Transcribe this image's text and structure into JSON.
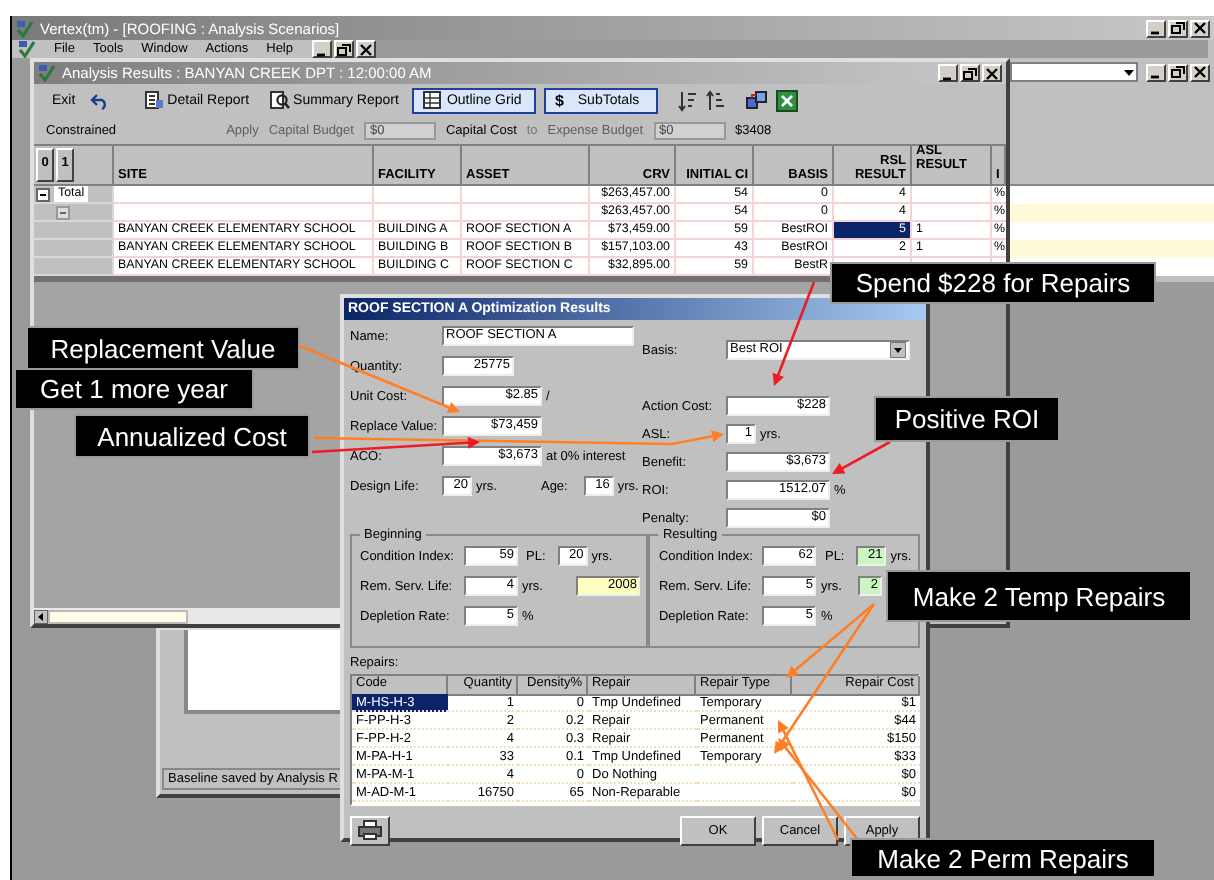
{
  "app_window": {
    "title": "Vertex(tm) - [ROOFING : Analysis Scenarios]",
    "menu": [
      "File",
      "Tools",
      "Window",
      "Actions",
      "Help"
    ]
  },
  "results_window": {
    "title": "Analysis Results : BANYAN CREEK DPT : 12:00:00 AM",
    "toolbar": {
      "exit": "Exit",
      "detail_report": "Detail Report",
      "summary_report": "Summary Report",
      "outline_grid": {
        "label": "Outline Grid",
        "on": true
      },
      "subtotals": {
        "symbol": "$",
        "label": "SubTotals",
        "on": true
      }
    },
    "budget": {
      "mode": "Constrained",
      "apply": {
        "label": "Apply",
        "disabled": true
      },
      "capital_budget": {
        "label": "Capital Budget",
        "value": "$0",
        "disabled": true
      },
      "capital_cost": "Capital Cost",
      "to": "to",
      "expense_budget": {
        "label": "Expense Budget",
        "value": "$0",
        "disabled": true
      },
      "total": "$3408"
    },
    "grid": {
      "levels": [
        "0",
        "1"
      ],
      "columns": [
        "SITE",
        "FACILITY",
        "ASSET",
        "CRV",
        "INITIAL CI",
        "BASIS",
        "RSL RESULT",
        "ASL RESULT",
        "I"
      ],
      "rows": [
        {
          "kind": "total",
          "label": "Total",
          "expanded": true,
          "selected": false,
          "cells": [
            "",
            "",
            "",
            "$263,457.00",
            "54",
            "0",
            "4",
            "",
            "%"
          ]
        },
        {
          "kind": "group",
          "expanded": true,
          "selected": false,
          "cells": [
            "",
            "",
            "",
            "$263,457.00",
            "54",
            "0",
            "4",
            "",
            "%"
          ]
        },
        {
          "kind": "asset",
          "selected": true,
          "cells": [
            "BANYAN CREEK ELEMENTARY SCHOOL",
            "BUILDING A",
            "ROOF SECTION A",
            "$73,459.00",
            "59",
            "BestROI",
            "5",
            "1",
            "%"
          ]
        },
        {
          "kind": "asset",
          "selected": false,
          "cells": [
            "BANYAN CREEK ELEMENTARY SCHOOL",
            "BUILDING B",
            "ROOF SECTION B",
            "$157,103.00",
            "43",
            "BestROI",
            "2",
            "1",
            "%"
          ]
        },
        {
          "kind": "asset",
          "selected": false,
          "cells": [
            "BANYAN CREEK ELEMENTARY SCHOOL",
            "BUILDING C",
            "ROOF SECTION C",
            "$32,895.00",
            "59",
            "BestR",
            "",
            "",
            ""
          ]
        }
      ]
    }
  },
  "baseline_window": {
    "status": "Baseline saved by Analysis R"
  },
  "dialog": {
    "title": "ROOF SECTION A Optimization Results",
    "name": {
      "label": "Name:",
      "value": "ROOF SECTION A"
    },
    "quantity": {
      "label": "Quantity:",
      "value": "25775"
    },
    "unit_cost": {
      "label": "Unit Cost:",
      "value": "$2.85",
      "unit": "/"
    },
    "replace_value": {
      "label": "Replace Value:",
      "value": "$73,459"
    },
    "aco": {
      "label": "ACO:",
      "value": "$3,673",
      "unit": "at 0% interest"
    },
    "design_life": {
      "label": "Design Life:",
      "value": "20",
      "unit": "yrs."
    },
    "age": {
      "label": "Age:",
      "value": "16",
      "unit": "yrs."
    },
    "basis": {
      "label": "Basis:",
      "value": "Best ROI"
    },
    "action_cost": {
      "label": "Action Cost:",
      "value": "$228"
    },
    "asl": {
      "label": "ASL:",
      "value": "1",
      "unit": "yrs."
    },
    "benefit": {
      "label": "Benefit:",
      "value": "$3,673"
    },
    "roi": {
      "label": "ROI:",
      "value": "1512.07",
      "unit": "%"
    },
    "penalty": {
      "label": "Penalty:",
      "value": "$0"
    },
    "beginning": {
      "title": "Beginning",
      "condition_index": {
        "label": "Condition Index:",
        "value": "59"
      },
      "pl": {
        "label": "PL:",
        "value": "20",
        "unit": "yrs."
      },
      "rem_serv_life": {
        "label": "Rem. Serv. Life:",
        "value": "4",
        "unit": "yrs."
      },
      "year": "2008",
      "depletion_rate": {
        "label": "Depletion Rate:",
        "value": "5",
        "unit": "%"
      }
    },
    "resulting": {
      "title": "Resulting",
      "condition_index": {
        "label": "Condition Index:",
        "value": "62"
      },
      "pl": {
        "label": "PL:",
        "value": "21",
        "unit": "yrs."
      },
      "rem_serv_life": {
        "label": "Rem. Serv. Life:",
        "value": "5",
        "unit": "yrs."
      },
      "year": "2",
      "depletion_rate": {
        "label": "Depletion Rate:",
        "value": "5",
        "unit": "%"
      }
    },
    "repairs": {
      "label": "Repairs:",
      "columns": [
        "Code",
        "Quantity",
        "Density%",
        "Repair",
        "Repair Type",
        "Repair Cost"
      ],
      "rows": [
        {
          "selected": true,
          "cells": [
            "M-HS-H-3",
            "1",
            "0",
            "Tmp Undefined",
            "Temporary",
            "$1"
          ]
        },
        {
          "selected": false,
          "cells": [
            "F-PP-H-3",
            "2",
            "0.2",
            "Repair",
            "Permanent",
            "$44"
          ]
        },
        {
          "selected": false,
          "cells": [
            "F-PP-H-2",
            "4",
            "0.3",
            "Repair",
            "Permanent",
            "$150"
          ]
        },
        {
          "selected": false,
          "cells": [
            "M-PA-H-1",
            "33",
            "0.1",
            "Tmp Undefined",
            "Temporary",
            "$33"
          ]
        },
        {
          "selected": false,
          "cells": [
            "M-PA-M-1",
            "4",
            "0",
            "Do Nothing",
            "",
            "$0"
          ]
        },
        {
          "selected": false,
          "cells": [
            "M-AD-M-1",
            "16750",
            "65",
            "Non-Reparable",
            "",
            "$0"
          ]
        }
      ]
    },
    "buttons": {
      "ok": "OK",
      "cancel": "Cancel",
      "apply": "Apply"
    }
  },
  "callouts": [
    {
      "text": "Replacement Value"
    },
    {
      "text": "Get 1 more year"
    },
    {
      "text": "Annualized Cost"
    },
    {
      "text": "Spend $228 for Repairs"
    },
    {
      "text": "Positive ROI"
    },
    {
      "text": "Make 2 Temp Repairs"
    },
    {
      "text": "Make 2 Perm Repairs"
    }
  ]
}
